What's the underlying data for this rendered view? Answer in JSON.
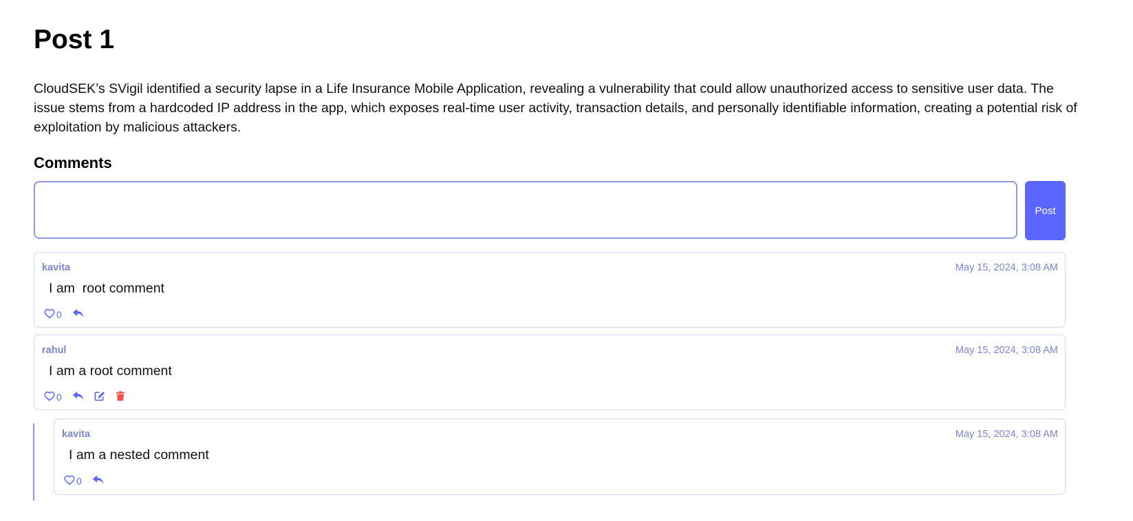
{
  "post": {
    "title": "Post 1",
    "body": "CloudSEK’s SVigil identified a security lapse in a Life Insurance Mobile Application, revealing a vulnerability that could allow unauthorized access to sensitive user data. The issue stems from a hardcoded IP address in the app, which exposes real-time user activity, transaction details, and personally identifiable information, creating a potential risk of exploitation by malicious attackers."
  },
  "comments_section": {
    "heading": "Comments",
    "input_value": "",
    "input_placeholder": "",
    "post_button_label": "Post"
  },
  "comments": [
    {
      "author": "kavita",
      "timestamp": "May 15, 2024, 3:08 AM",
      "text": "I am  root comment",
      "likes": "0",
      "nested": false,
      "actions": [
        "like",
        "reply"
      ]
    },
    {
      "author": "rahul",
      "timestamp": "May 15, 2024, 3:08 AM",
      "text": "I am a root comment",
      "likes": "0",
      "nested": false,
      "actions": [
        "like",
        "reply",
        "edit",
        "delete"
      ]
    },
    {
      "author": "kavita",
      "timestamp": "May 15, 2024, 3:08 AM",
      "text": "I am a nested comment",
      "likes": "0",
      "nested": true,
      "actions": [
        "like",
        "reply"
      ]
    }
  ],
  "colors": {
    "accent": "#5a66ff",
    "delete": "#ff4d4f",
    "meta_text": "#7d84d3",
    "card_border": "#d3d6f3"
  },
  "icons": {
    "like": "heart-icon",
    "reply": "reply-icon",
    "edit": "edit-icon",
    "delete": "trash-icon"
  }
}
